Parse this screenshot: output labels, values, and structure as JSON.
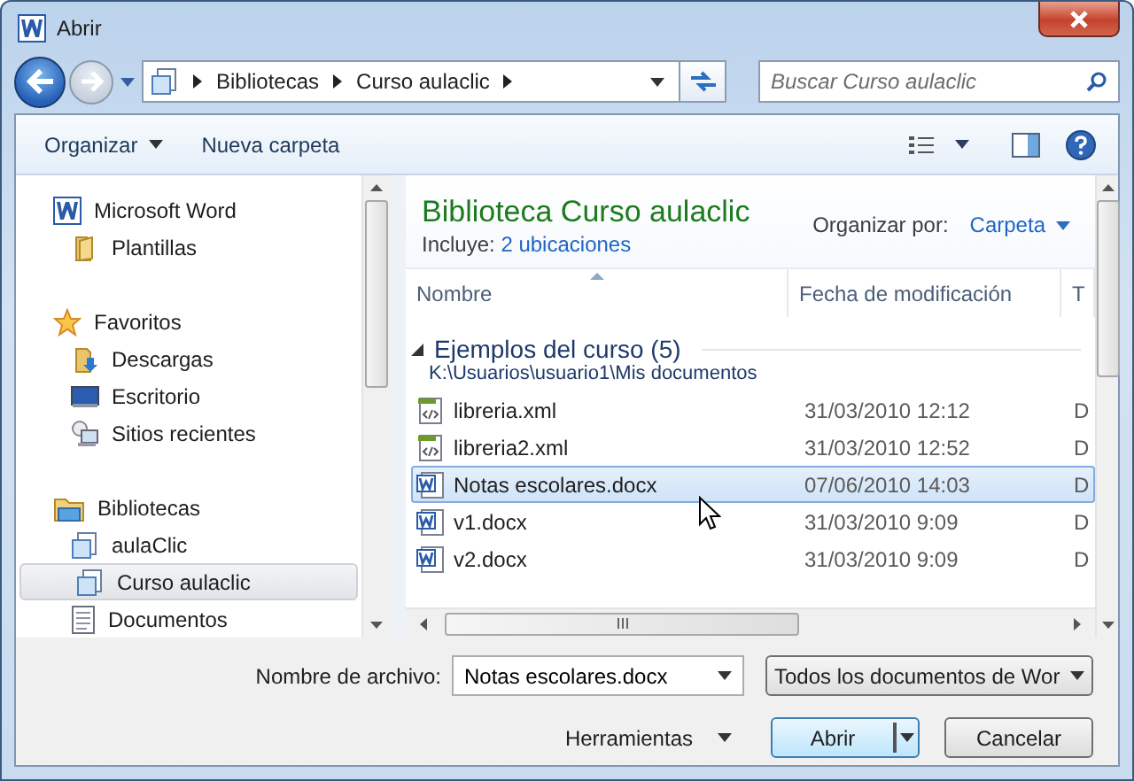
{
  "window": {
    "title": "Abrir"
  },
  "address": {
    "crumbs": [
      "Bibliotecas",
      "Curso aulaclic"
    ]
  },
  "search": {
    "placeholder": "Buscar Curso aulaclic"
  },
  "toolbar": {
    "buttons": [
      "Organizar",
      "Nueva carpeta"
    ]
  },
  "sidebar": {
    "items": [
      {
        "kind": "group",
        "label": "Microsoft Word",
        "selected": false
      },
      {
        "kind": "item",
        "label": "Plantillas",
        "selected": false
      },
      {
        "kind": "gap"
      },
      {
        "kind": "group",
        "label": "Favoritos",
        "selected": false
      },
      {
        "kind": "item",
        "label": "Descargas",
        "selected": false
      },
      {
        "kind": "item",
        "label": "Escritorio",
        "selected": false
      },
      {
        "kind": "item",
        "label": "Sitios recientes",
        "selected": false
      },
      {
        "kind": "gap"
      },
      {
        "kind": "group",
        "label": "Bibliotecas",
        "selected": false
      },
      {
        "kind": "item",
        "label": "aulaClic",
        "selected": false
      },
      {
        "kind": "item",
        "label": "Curso aulaclic",
        "selected": true
      },
      {
        "kind": "item",
        "label": "Documentos",
        "selected": false
      }
    ]
  },
  "library": {
    "title": "Biblioteca Curso aulaclic",
    "includes_label": "Incluye:",
    "includes_link": "2 ubicaciones",
    "arrange_label": "Organizar por:",
    "arrange_value": "Carpeta"
  },
  "table": {
    "columns": [
      "Nombre",
      "Fecha de modificación",
      "T"
    ],
    "group": {
      "title": "Ejemplos del curso (5)",
      "path": "K:\\Usuarios\\usuario1\\Mis documentos",
      "expanded": true
    },
    "rows": [
      {
        "kind": "xml",
        "name": "libreria.xml",
        "date": "31/03/2010 12:12",
        "column_3": "D",
        "selected": false
      },
      {
        "kind": "xml",
        "name": "libreria2.xml",
        "date": "31/03/2010 12:52",
        "column_3": "D",
        "selected": false
      },
      {
        "kind": "docx",
        "name": "Notas escolares.docx",
        "date": "07/06/2010 14:03",
        "column_3": "D",
        "selected": true
      },
      {
        "kind": "docx",
        "name": "v1.docx",
        "date": "31/03/2010 9:09",
        "column_3": "D",
        "selected": false
      },
      {
        "kind": "docx",
        "name": "v2.docx",
        "date": "31/03/2010 9:09",
        "column_3": "D",
        "selected": false
      }
    ]
  },
  "filename": {
    "label": "Nombre de archivo:",
    "value": "Notas escolares.docx"
  },
  "filter": {
    "value": "Todos los documentos de Wor"
  },
  "buttons": {
    "tools": "Herramientas",
    "open": "Abrir",
    "cancel": "Cancelar"
  }
}
